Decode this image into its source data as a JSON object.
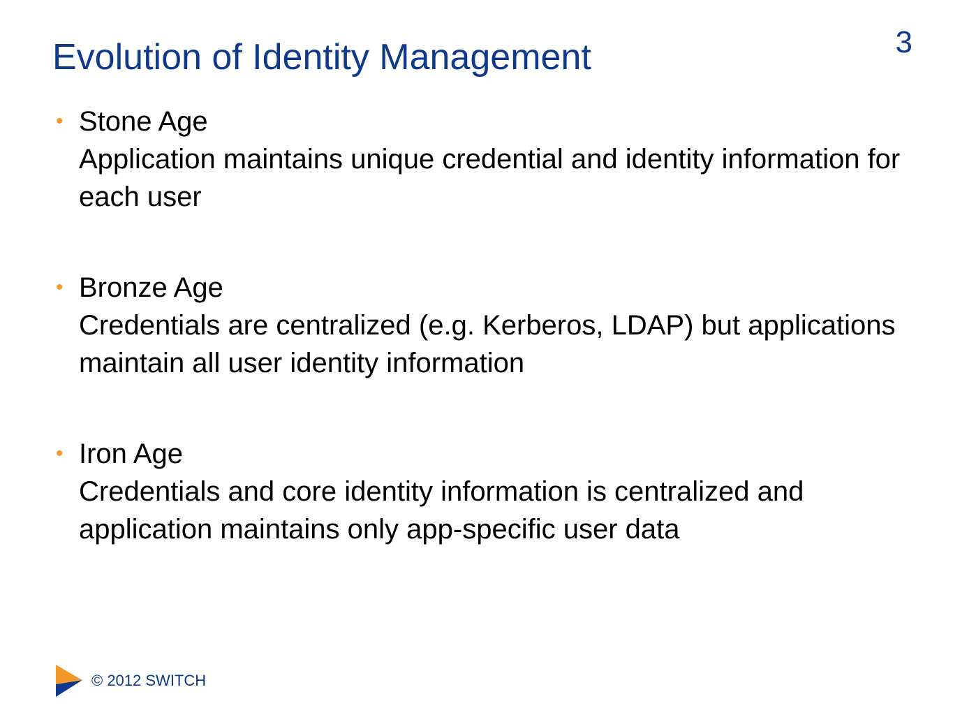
{
  "slide": {
    "title": "Evolution of Identity Management",
    "page_number": "3"
  },
  "bullets": [
    {
      "heading": "Stone Age",
      "text": "Application maintains unique credential and identity information for each user"
    },
    {
      "heading": "Bronze Age",
      "text": "Credentials are centralized (e.g. Kerberos, LDAP) but applications maintain all user identity information"
    },
    {
      "heading": "Iron Age",
      "text": "Credentials and core identity information is centralized and application maintains only app-specific user data"
    }
  ],
  "footer": {
    "copyright": "© 2012 SWITCH",
    "logo_icon": "switch-chevron-logo"
  },
  "colors": {
    "title": "#0f3a8c",
    "bullet": "#f39a2b",
    "logo_orange": "#f39a2b",
    "logo_blue": "#0f3a8c",
    "body_text": "#000000",
    "background": "#ffffff"
  }
}
